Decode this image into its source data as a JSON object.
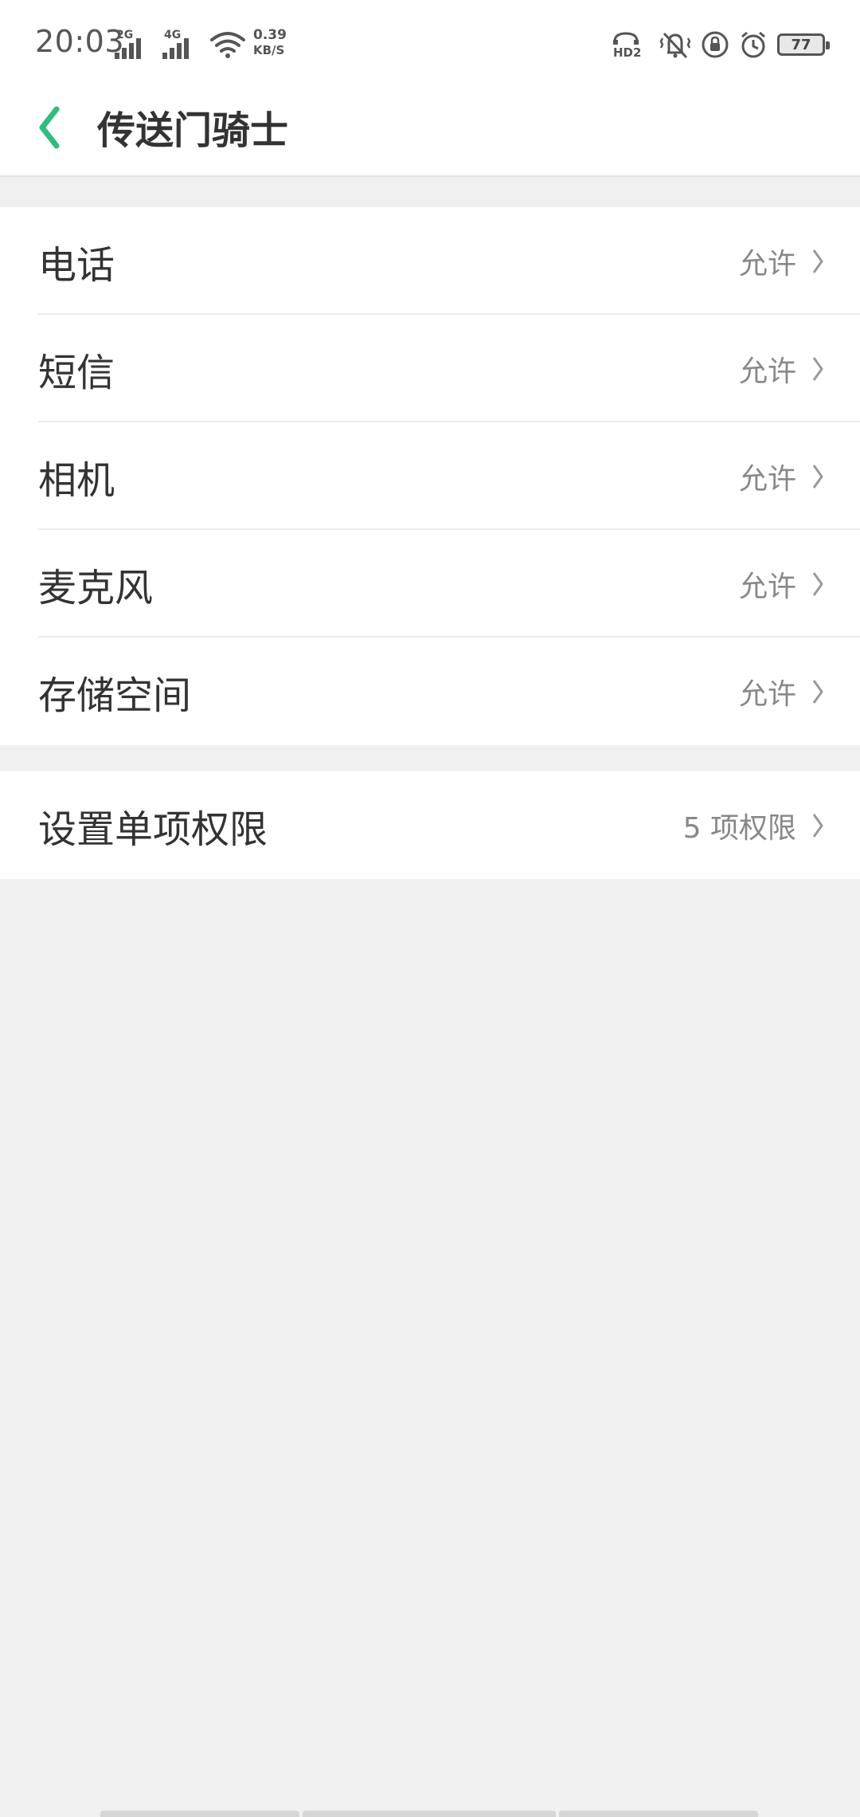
{
  "status_bar": {
    "time": "20:03",
    "signal_1_label": "2G",
    "signal_2_label": "4G",
    "net_speed_value": "0.39",
    "net_speed_unit": "KB/S",
    "hd_label": "HD2",
    "battery_level": "77",
    "icons": [
      "signal-icon",
      "wifi-icon",
      "hd-voice-icon",
      "vibrate-icon",
      "rotation-lock-icon",
      "alarm-icon",
      "battery-icon"
    ]
  },
  "header": {
    "title": "传送门骑士"
  },
  "permissions": [
    {
      "label": "电话",
      "value": "允许"
    },
    {
      "label": "短信",
      "value": "允许"
    },
    {
      "label": "相机",
      "value": "允许"
    },
    {
      "label": "麦克风",
      "value": "允许"
    },
    {
      "label": "存储空间",
      "value": "允许"
    }
  ],
  "individual": {
    "label": "设置单项权限",
    "value": "5 项权限"
  },
  "colors": {
    "accent": "#2ebd7c",
    "background": "#f0f0f0",
    "card": "#ffffff",
    "secondary_text": "#888888"
  }
}
